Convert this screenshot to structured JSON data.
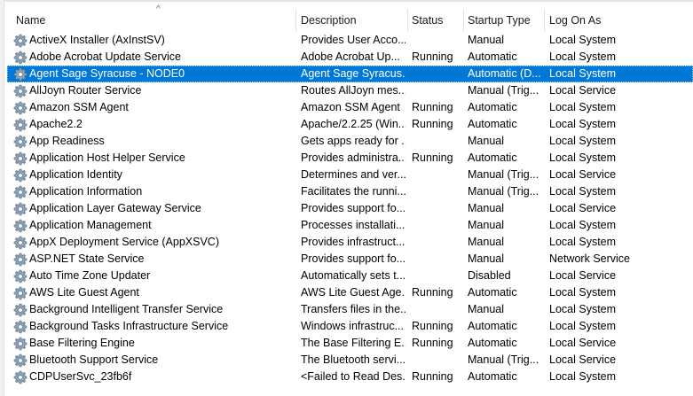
{
  "columns": {
    "name": "Name",
    "description": "Description",
    "status": "Status",
    "startup_type": "Startup Type",
    "log_on_as": "Log On As"
  },
  "sort_indicator": "^",
  "icon": "gear-service-icon",
  "colors": {
    "selected_background": "#0078d7",
    "selected_text": "#ffffff"
  },
  "services": [
    {
      "name": "ActiveX Installer (AxInstSV)",
      "description": "Provides User Acco...",
      "status": "",
      "startup": "Manual",
      "logon": "Local System"
    },
    {
      "name": "Adobe Acrobat Update Service",
      "description": "Adobe Acrobat Up...",
      "status": "Running",
      "startup": "Automatic",
      "logon": "Local System"
    },
    {
      "name": "Agent Sage Syracuse - NODE0",
      "description": "Agent Sage Syracus...",
      "status": "",
      "startup": "Automatic (D...",
      "logon": "Local System",
      "selected": true
    },
    {
      "name": "AllJoyn Router Service",
      "description": "Routes AllJoyn mes...",
      "status": "",
      "startup": "Manual (Trig...",
      "logon": "Local Service"
    },
    {
      "name": "Amazon SSM Agent",
      "description": "Amazon SSM Agent",
      "status": "Running",
      "startup": "Automatic",
      "logon": "Local System"
    },
    {
      "name": "Apache2.2",
      "description": "Apache/2.2.25 (Win...",
      "status": "Running",
      "startup": "Automatic",
      "logon": "Local System"
    },
    {
      "name": "App Readiness",
      "description": "Gets apps ready for ...",
      "status": "",
      "startup": "Manual",
      "logon": "Local System"
    },
    {
      "name": "Application Host Helper Service",
      "description": "Provides administra...",
      "status": "Running",
      "startup": "Automatic",
      "logon": "Local System"
    },
    {
      "name": "Application Identity",
      "description": "Determines and ver...",
      "status": "",
      "startup": "Manual (Trig...",
      "logon": "Local Service"
    },
    {
      "name": "Application Information",
      "description": "Facilitates the runni...",
      "status": "",
      "startup": "Manual (Trig...",
      "logon": "Local System"
    },
    {
      "name": "Application Layer Gateway Service",
      "description": "Provides support fo...",
      "status": "",
      "startup": "Manual",
      "logon": "Local Service"
    },
    {
      "name": "Application Management",
      "description": "Processes installati...",
      "status": "",
      "startup": "Manual",
      "logon": "Local System"
    },
    {
      "name": "AppX Deployment Service (AppXSVC)",
      "description": "Provides infrastruct...",
      "status": "",
      "startup": "Manual",
      "logon": "Local System"
    },
    {
      "name": "ASP.NET State Service",
      "description": "Provides support fo...",
      "status": "",
      "startup": "Manual",
      "logon": "Network Service"
    },
    {
      "name": "Auto Time Zone Updater",
      "description": "Automatically sets t...",
      "status": "",
      "startup": "Disabled",
      "logon": "Local Service"
    },
    {
      "name": "AWS Lite Guest Agent",
      "description": "AWS Lite Guest Age...",
      "status": "Running",
      "startup": "Automatic",
      "logon": "Local System"
    },
    {
      "name": "Background Intelligent Transfer Service",
      "description": "Transfers files in the...",
      "status": "",
      "startup": "Manual",
      "logon": "Local System"
    },
    {
      "name": "Background Tasks Infrastructure Service",
      "description": "Windows infrastruc...",
      "status": "Running",
      "startup": "Automatic",
      "logon": "Local System"
    },
    {
      "name": "Base Filtering Engine",
      "description": "The Base Filtering E...",
      "status": "Running",
      "startup": "Automatic",
      "logon": "Local Service"
    },
    {
      "name": "Bluetooth Support Service",
      "description": "The Bluetooth servi...",
      "status": "",
      "startup": "Manual (Trig...",
      "logon": "Local Service"
    },
    {
      "name": "CDPUserSvc_23fb6f",
      "description": "<Failed to Read Des...",
      "status": "Running",
      "startup": "Automatic",
      "logon": "Local System"
    }
  ]
}
